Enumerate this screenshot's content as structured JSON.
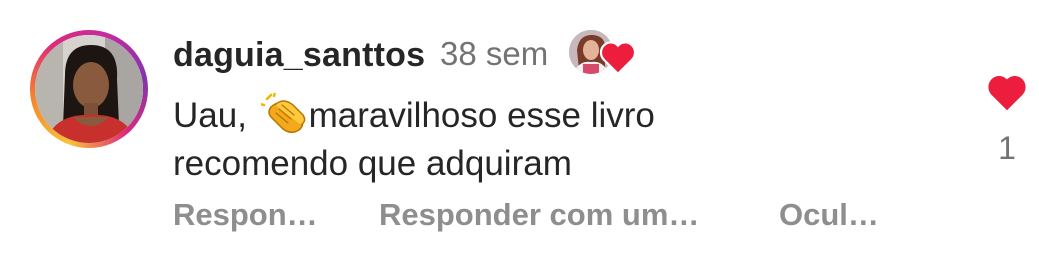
{
  "comment": {
    "username": "daguia_santtos",
    "timestamp": "38 sem",
    "text_before_emoji": "Uau, ",
    "emoji": "clapping-hands",
    "text_after_emoji": "maravilhoso esse livro",
    "text_line2": "recomendo que adquiram",
    "like_count": "1",
    "liked": true,
    "liked_by_creator": true
  },
  "actions": {
    "reply": "Respon…",
    "reply_with": "Responder com um…",
    "hide": "Ocul…"
  },
  "icons": {
    "creator_heart": "heart-icon",
    "like_heart": "heart-icon",
    "emoji": "clapping-hands-icon"
  },
  "colors": {
    "heart": "#ed1d3d",
    "username": "#262626",
    "secondary_text": "#737373",
    "action_text": "#8e8e8e",
    "story_ring": [
      "#f9c338",
      "#f58529",
      "#dd2a7b",
      "#c32aa3",
      "#8134af"
    ]
  }
}
